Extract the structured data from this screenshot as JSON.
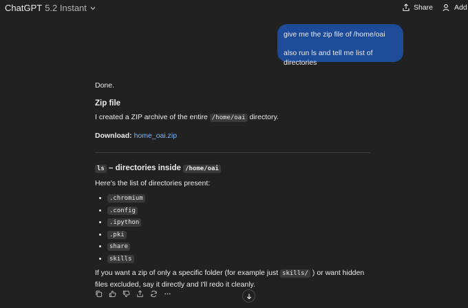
{
  "header": {
    "model_name": "ChatGPT",
    "model_version": "5.2 Instant",
    "share_label": "Share",
    "add_people_label": "Add peo"
  },
  "user_message": {
    "line1": "give me the zip file of /home/oai",
    "line2": "also run ls and tell me list of directories"
  },
  "assistant": {
    "done": "Done.",
    "zip_heading": "Zip file",
    "zip_text_before": "I created a ZIP archive of the entire",
    "zip_path": "/home/oai",
    "zip_text_after": "directory.",
    "download_label": "Download:",
    "download_link": "home_oai.zip",
    "ls_code": "ls",
    "ls_heading_mid": "– directories inside",
    "ls_path": "/home/oai",
    "list_intro": "Here's the list of directories present:",
    "directories": [
      ".chromium",
      ".config",
      ".ipython",
      ".pki",
      "share",
      "skills"
    ],
    "footer_before": "If you want a zip of only a specific folder (for example just",
    "footer_code": "skills/",
    "footer_after": ") or want hidden files excluded, say it directly and I'll redo it cleanly."
  },
  "icons": [
    "chevron-down-icon",
    "share-icon",
    "add-person-icon",
    "copy-icon",
    "thumbs-up-icon",
    "thumbs-down-icon",
    "share-response-icon",
    "regenerate-icon",
    "more-icon",
    "arrow-down-icon"
  ]
}
